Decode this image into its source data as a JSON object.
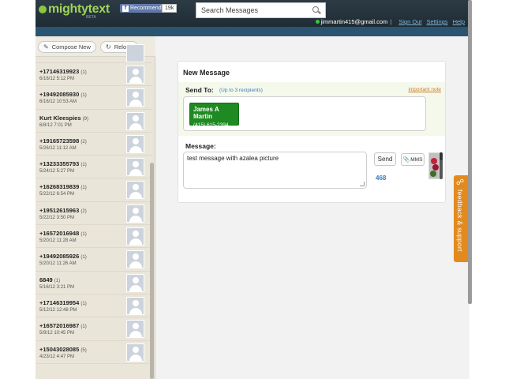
{
  "header": {
    "logo_text": "mightytext",
    "logo_badge": "BETA",
    "facebook": {
      "label": "Recommend",
      "count": "19k"
    },
    "search_placeholder": "Search Messages",
    "user_email": "jimmartin415@gmail.com",
    "separator": "|",
    "links": [
      "Sign Out",
      "Settings",
      "Help"
    ]
  },
  "sidebar": {
    "compose_label": "Compose New",
    "reload_label": "Reload",
    "contacts": [
      {
        "name": "+17146319923",
        "count": "(1)",
        "date": "6/16/12 5:12 PM"
      },
      {
        "name": "+19492085930",
        "count": "(1)",
        "date": "6/16/12 10:53 AM"
      },
      {
        "name": "Kurt Kleespies",
        "count": "(9)",
        "date": "6/8/12 7:01 PM"
      },
      {
        "name": "+19165723598",
        "count": "(2)",
        "date": "5/26/12 11:12 AM"
      },
      {
        "name": "+13233355793",
        "count": "(1)",
        "date": "5/24/12 5:27 PM"
      },
      {
        "name": "+16268319839",
        "count": "(1)",
        "date": "5/22/12 6:54 PM"
      },
      {
        "name": "+19512615963",
        "count": "(2)",
        "date": "5/22/12 3:50 PM"
      },
      {
        "name": "+16572016948",
        "count": "(1)",
        "date": "5/20/12 11:28 AM"
      },
      {
        "name": "+19492085926",
        "count": "(1)",
        "date": "5/20/12 11:26 AM"
      },
      {
        "name": "6849",
        "count": "(1)",
        "date": "5/16/12 3:21 PM"
      },
      {
        "name": "+17146319954",
        "count": "(1)",
        "date": "5/12/12 12:48 PM"
      },
      {
        "name": "+16572016987",
        "count": "(1)",
        "date": "5/9/12 10:45 PM"
      },
      {
        "name": "+15043028085",
        "count": "(5)",
        "date": "4/23/12 4:47 PM"
      }
    ]
  },
  "compose": {
    "title": "New Message",
    "send_to_label": "Send To:",
    "send_to_hint": "(Up to 3 recipients)",
    "important_note": "important note",
    "recipient": {
      "name": "James A Martin",
      "phone": "(415) 615-2394"
    },
    "message_label": "Message:",
    "message_value": "test message with azalea picture",
    "send_label": "Send",
    "mms_label": "MMS",
    "char_count": "468"
  },
  "feedback_label": "feedback & support",
  "colors": {
    "header_bg": "#2c3b45",
    "logo_green": "#9fd35a",
    "chip_green": "#1e8a21",
    "link_blue": "#2f7fc7",
    "feedback_orange": "#e38a1e"
  },
  "icons": [
    "pencil-icon",
    "reload-icon",
    "search-icon",
    "paperclip-icon",
    "feedback-icon",
    "facebook-icon",
    "avatar-icon"
  ]
}
